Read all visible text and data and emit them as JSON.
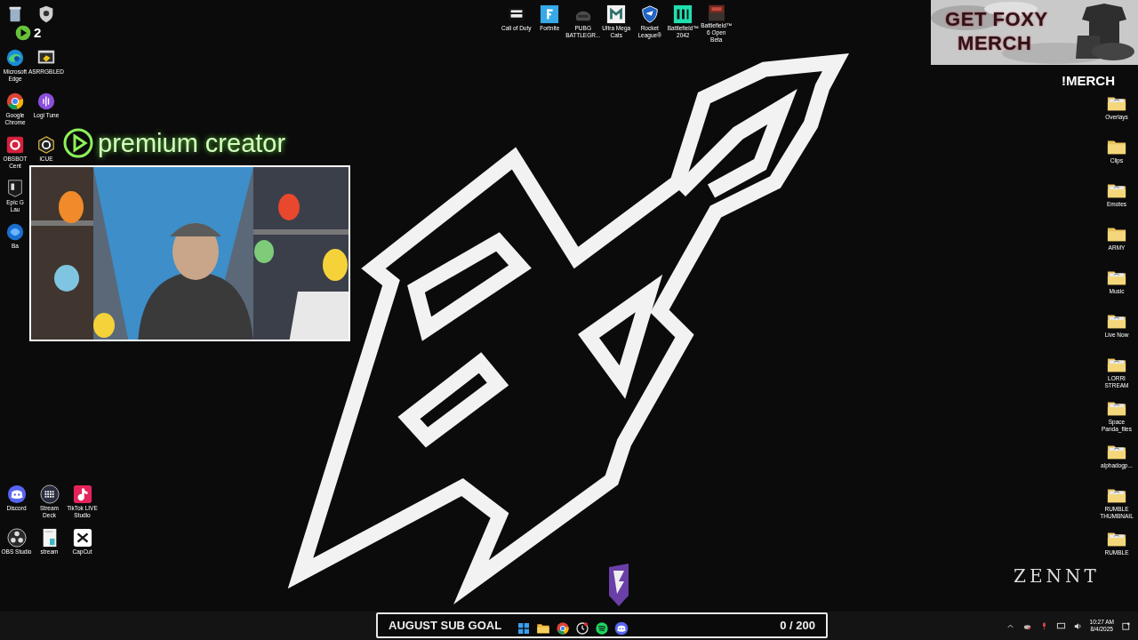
{
  "desktop_left_top": [
    {
      "kind": "recycle"
    },
    {
      "kind": "shield"
    },
    {
      "kind": "edge",
      "label": "Microsoft Edge"
    },
    {
      "kind": "monitor",
      "label": "ASRRGBLED"
    },
    {
      "kind": "chrome",
      "label": "Google Chrome"
    },
    {
      "kind": "wave",
      "label": "Logi Tune"
    },
    {
      "kind": "camera",
      "label": "OBSBOT Cent"
    },
    {
      "kind": "hexagon",
      "label": "iCUE"
    },
    {
      "kind": "epic",
      "label": "Epic G Lau"
    },
    {
      "kind": "blank"
    },
    {
      "kind": "globe",
      "label": "Ba"
    }
  ],
  "overlay_badge": {
    "count": "2"
  },
  "desktop_top": [
    {
      "kind": "cod",
      "label": "Call of Duty"
    },
    {
      "kind": "fortnite",
      "label": "Fortnite"
    },
    {
      "kind": "helmet",
      "label": "PUBG BATTLEGR..."
    },
    {
      "kind": "umc",
      "label": "Ultra Mega Cats"
    },
    {
      "kind": "rocket",
      "label": "Rocket League®"
    },
    {
      "kind": "bf",
      "label": "Battlefield™ 2042"
    },
    {
      "kind": "cover",
      "label": "Battlefield™ 6 Open Beta"
    }
  ],
  "desktop_right": [
    {
      "kind": "folder_img",
      "label": "Overlays"
    },
    {
      "kind": "folder",
      "label": "Clips"
    },
    {
      "kind": "folder_img",
      "label": "Emotes"
    },
    {
      "kind": "folder",
      "label": "ARMY"
    },
    {
      "kind": "folder_img",
      "label": "Music"
    },
    {
      "kind": "folder_img",
      "label": "Live Now"
    },
    {
      "kind": "folder_img",
      "label": "LORRI STREAM"
    },
    {
      "kind": "folder_img",
      "label": "Space Panda_files"
    },
    {
      "kind": "folder_img",
      "label": "alphadogp..."
    },
    {
      "kind": "folder_img",
      "label": "RUMBLE THUMBNAIL"
    },
    {
      "kind": "folder_img",
      "label": "RUMBLE"
    }
  ],
  "desktop_bottom_left": [
    {
      "kind": "discord",
      "label": "Discord"
    },
    {
      "kind": "keypad",
      "label": "Stream Deck"
    },
    {
      "kind": "tiktok",
      "label": "TikTok LIVE Studio"
    },
    {
      "kind": "obs",
      "label": "OBS Studio"
    },
    {
      "kind": "doc",
      "label": "stream"
    },
    {
      "kind": "capcut",
      "label": "CapCut"
    }
  ],
  "stream_overlay": {
    "creator_label": "premium creator",
    "merch_title": "GET FOXY",
    "merch_title_2": "MERCH",
    "merch_command": "!MERCH",
    "brand": "ZENNT",
    "sub_goal": {
      "title": "AUGUST SUB GOAL",
      "count": "0 / 200"
    }
  },
  "taskbar": {
    "apps": [
      {
        "kind": "windows"
      },
      {
        "kind": "explorer"
      },
      {
        "kind": "chrome"
      },
      {
        "kind": "clock"
      },
      {
        "kind": "spotify"
      },
      {
        "kind": "discord"
      }
    ],
    "time": "10:27 AM",
    "date": "8/4/2025"
  }
}
